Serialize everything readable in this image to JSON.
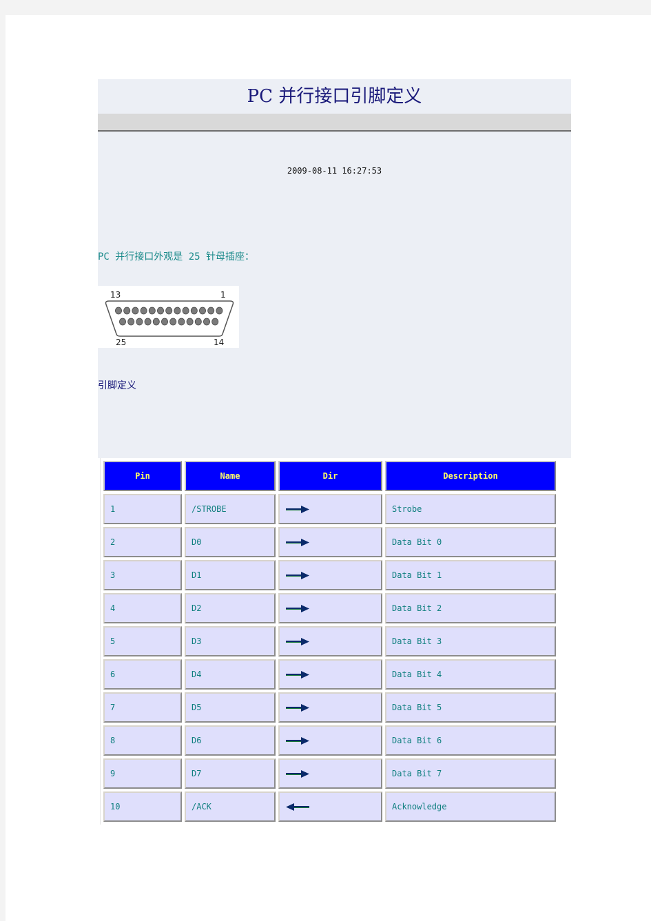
{
  "article": {
    "title": "PC 并行接口引脚定义",
    "timestamp": "2009-08-11 16:27:53",
    "intro": "PC 并行接口外观是 25 针母插座：",
    "connector": {
      "label_top_left": "13",
      "label_top_right": "1",
      "label_bottom_left": "25",
      "label_bottom_right": "14",
      "top_row_pins": 13,
      "bottom_row_pins": 12
    },
    "section_label": "引脚定义"
  },
  "table": {
    "headers": [
      "Pin",
      "Name",
      "Dir",
      "Description"
    ],
    "colors": {
      "header_bg": "#0000ff",
      "header_text": "#ffff66",
      "cell_bg": "#dfdffc",
      "cell_text": "#0f7f7f"
    },
    "rows": [
      {
        "pin": "1",
        "name": "/STROBE",
        "dir": "out",
        "dir_icon": "arrow-right-icon",
        "description": "Strobe"
      },
      {
        "pin": "2",
        "name": "D0",
        "dir": "out",
        "dir_icon": "arrow-right-icon",
        "description": "Data Bit 0"
      },
      {
        "pin": "3",
        "name": "D1",
        "dir": "out",
        "dir_icon": "arrow-right-icon",
        "description": "Data Bit 1"
      },
      {
        "pin": "4",
        "name": "D2",
        "dir": "out",
        "dir_icon": "arrow-right-icon",
        "description": "Data Bit 2"
      },
      {
        "pin": "5",
        "name": "D3",
        "dir": "out",
        "dir_icon": "arrow-right-icon",
        "description": "Data Bit 3"
      },
      {
        "pin": "6",
        "name": "D4",
        "dir": "out",
        "dir_icon": "arrow-right-icon",
        "description": "Data Bit 4"
      },
      {
        "pin": "7",
        "name": "D5",
        "dir": "out",
        "dir_icon": "arrow-right-icon",
        "description": "Data Bit 5"
      },
      {
        "pin": "8",
        "name": "D6",
        "dir": "out",
        "dir_icon": "arrow-right-icon",
        "description": "Data Bit 6"
      },
      {
        "pin": "9",
        "name": "D7",
        "dir": "out",
        "dir_icon": "arrow-right-icon",
        "description": "Data Bit 7"
      },
      {
        "pin": "10",
        "name": "/ACK",
        "dir": "in",
        "dir_icon": "arrow-left-icon",
        "description": "Acknowledge"
      }
    ]
  }
}
